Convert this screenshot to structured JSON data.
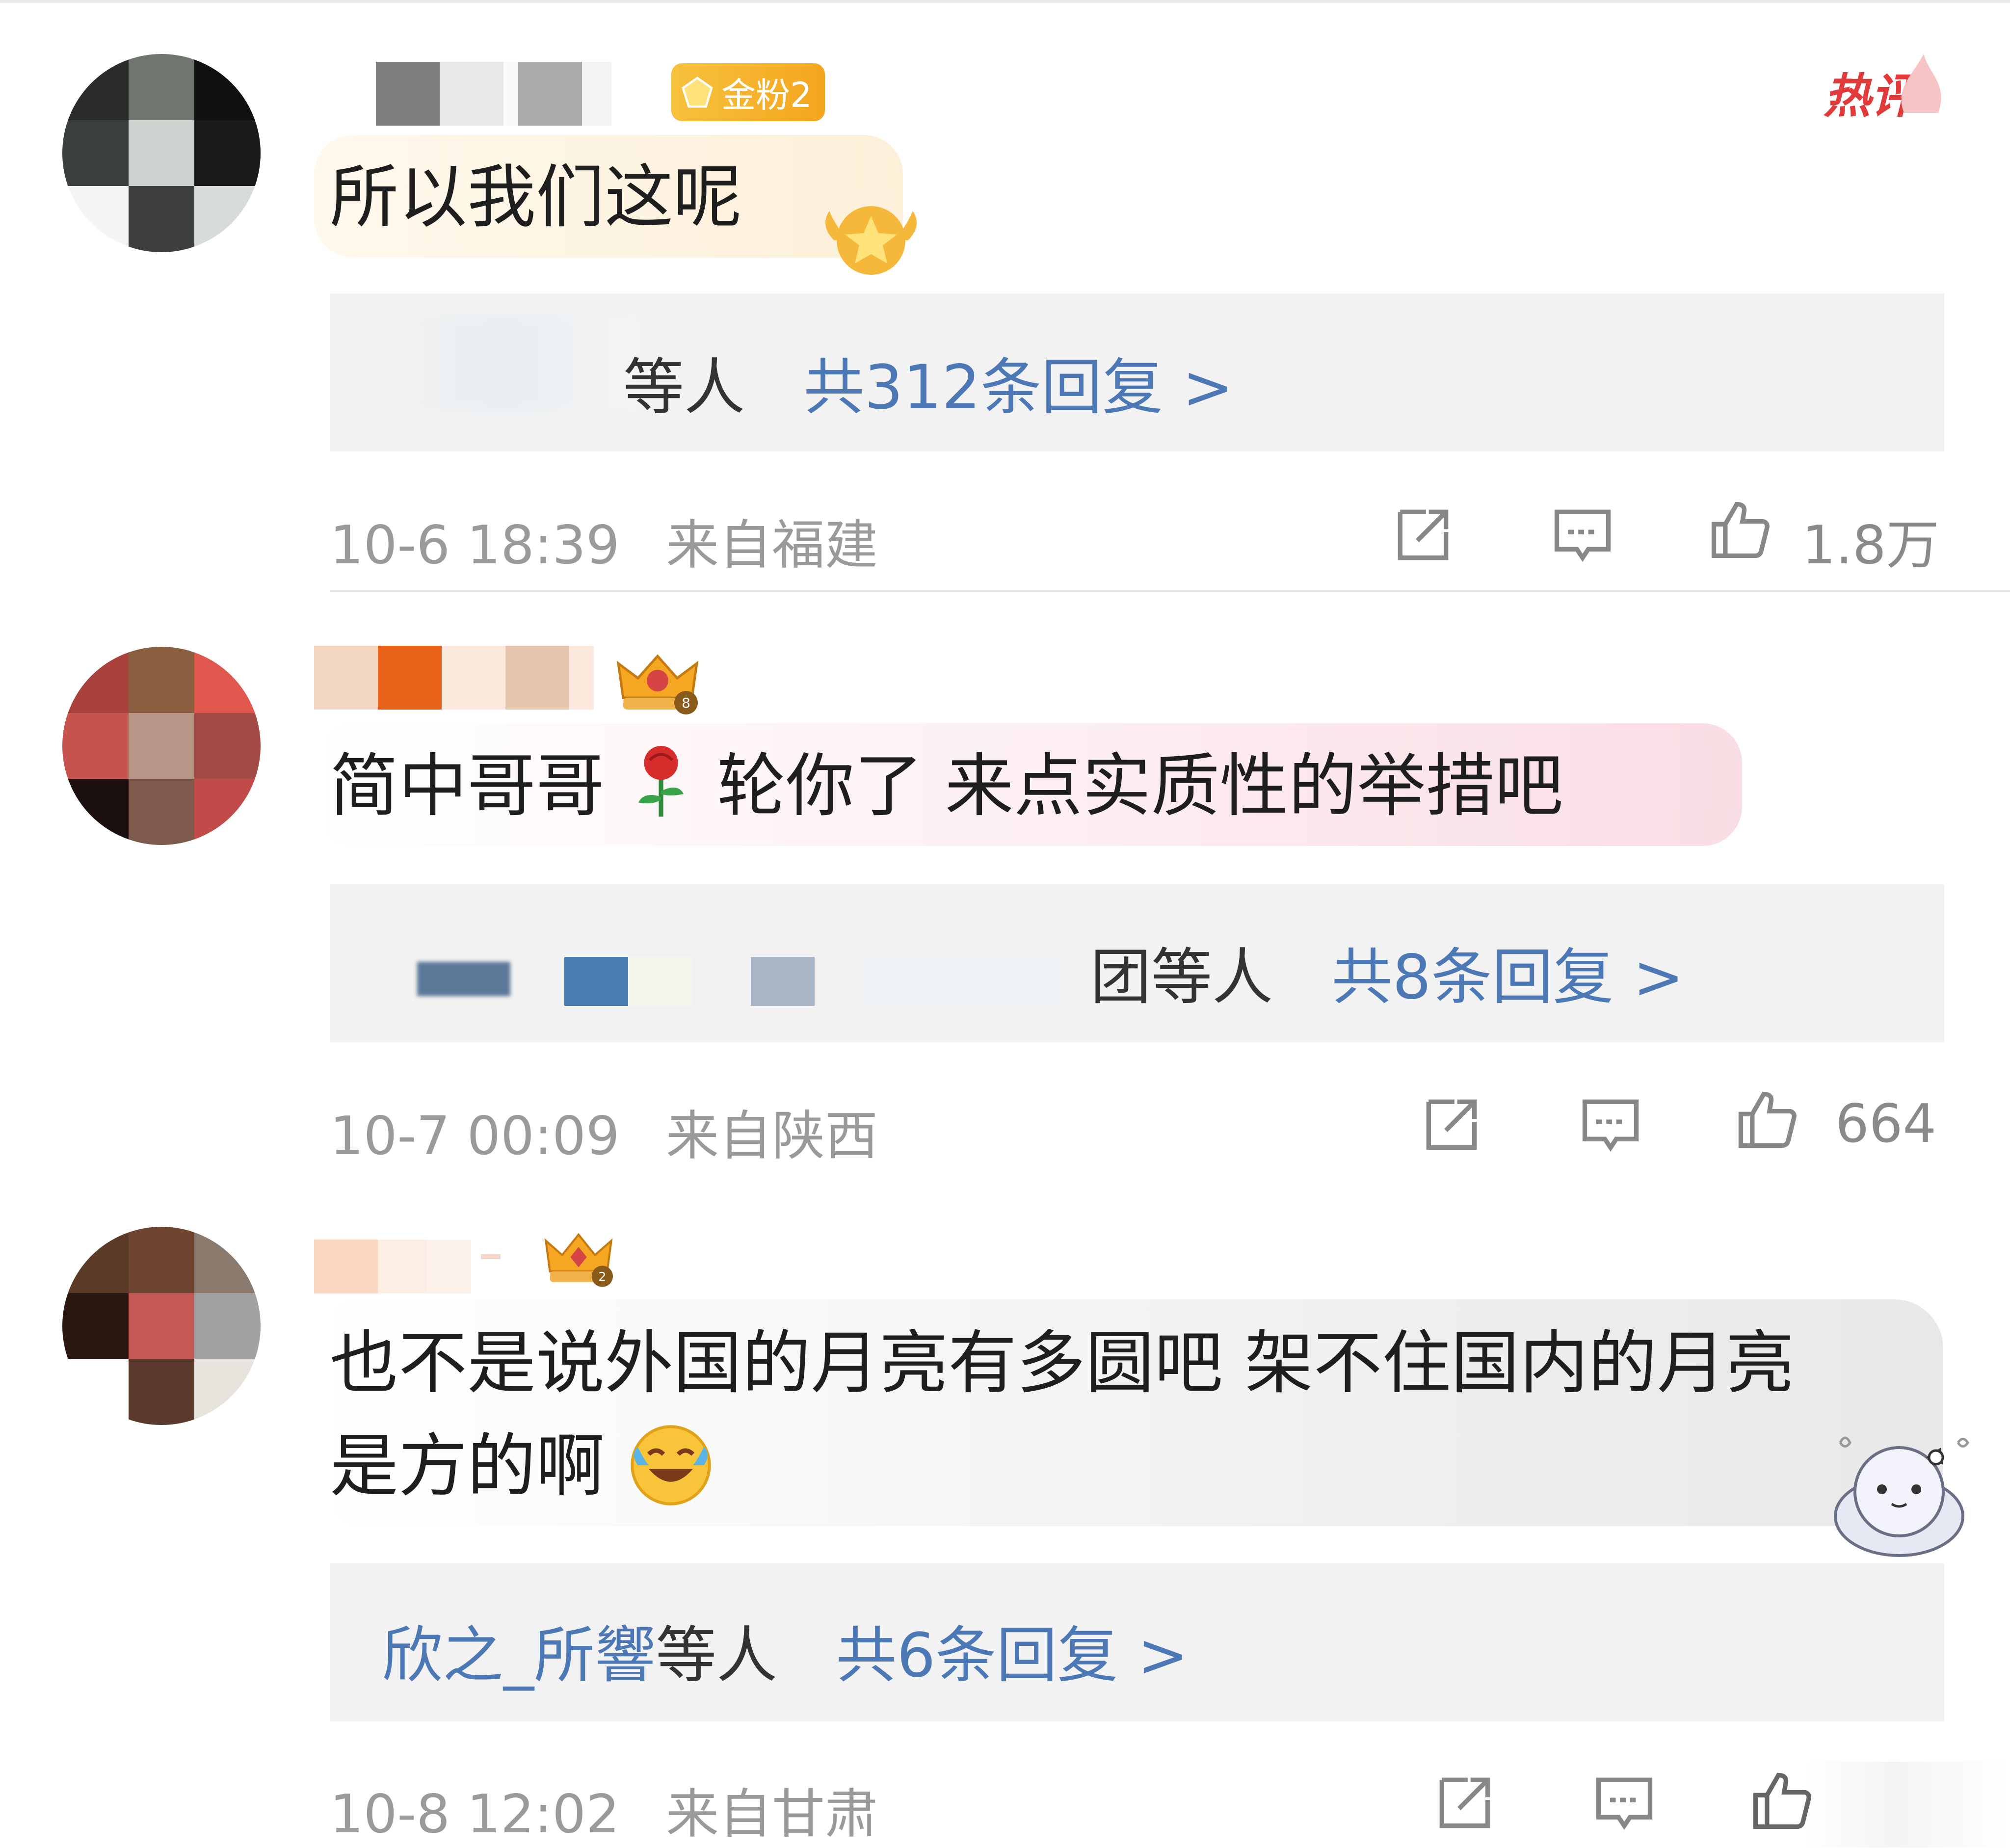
{
  "comments": [
    {
      "badge": "金粉2",
      "hot_label": "热评",
      "text": "所以我们这呢",
      "reply_suffix": "等人",
      "reply_count": "共312条回复 >",
      "time": "10-6 18:39",
      "location": "来自福建",
      "likes": "1.8万"
    },
    {
      "badge": "",
      "text_part1": "简中哥哥",
      "text_part2": "轮你了 来点实质性的举措吧",
      "reply_suffix": "团等人",
      "reply_count": "共8条回复 >",
      "time": "10-7 00:09",
      "location": "来自陕西",
      "likes": "664"
    },
    {
      "text_line1": "也不是说外国的月亮有多圆吧 架不住国内的月亮",
      "text_line2": "是方的啊",
      "reply_user": "欣之_所響",
      "reply_suffix": "等人",
      "reply_count": "共6条回复 >",
      "time": "10-8 12:02",
      "location": "来自甘肃",
      "likes": ""
    }
  ],
  "icons": {
    "share": "share-icon",
    "reply": "comment-icon",
    "like": "thumbs-up-icon",
    "rose": "rose-emoji",
    "laugh": "laughing-emoji",
    "crown": "crown-badge-icon"
  },
  "colors": {
    "link_blue": "#4c78b5",
    "meta_gray": "#9a9a9a",
    "hot_red": "#e23a3a",
    "badge_gold": "#f4a51f"
  }
}
